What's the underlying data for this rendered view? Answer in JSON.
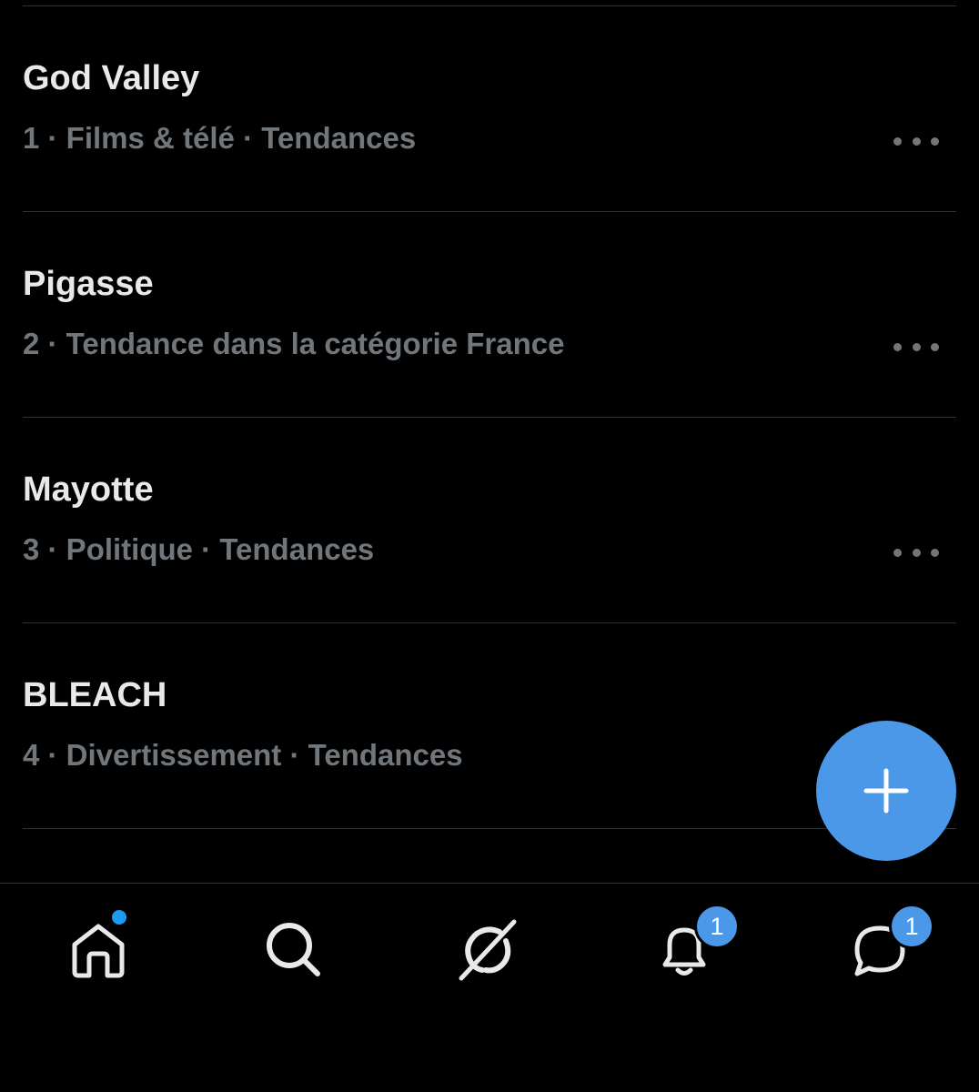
{
  "trends": [
    {
      "title": "God Valley",
      "meta": "1 · Films & télé · Tendances"
    },
    {
      "title": "Pigasse",
      "meta": "2 · Tendance dans la catégorie France"
    },
    {
      "title": "Mayotte",
      "meta": "3 · Politique · Tendances"
    },
    {
      "title": "BLEACH",
      "meta": "4 · Divertissement · Tendances"
    }
  ],
  "fab": {
    "icon": "plus-icon",
    "color": "#4c98e8"
  },
  "nav": {
    "home": {
      "icon": "home-icon",
      "has_dot": true
    },
    "search": {
      "icon": "search-icon"
    },
    "grok": {
      "icon": "grok-icon"
    },
    "notifications": {
      "icon": "bell-icon",
      "badge": "1"
    },
    "messages": {
      "icon": "message-icon",
      "badge": "1"
    }
  },
  "colors": {
    "background": "#000000",
    "text_primary": "#e7e9ea",
    "text_secondary": "#71767b",
    "accent": "#4c98e8",
    "divider": "#2f3336"
  }
}
